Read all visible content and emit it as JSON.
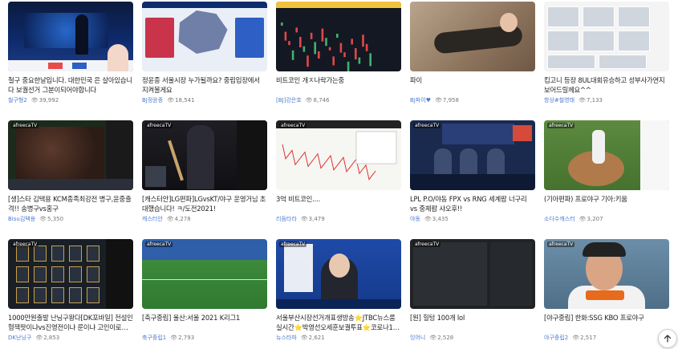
{
  "videos": [
    {
      "title": "철구 중요한날입니다. 대한민국 은 살아있습니다 보궐선거 그분이되어야합니다",
      "bj": "철구형2",
      "views": "39,992",
      "thumb": "news1",
      "badge": ""
    },
    {
      "title": "정윤종 서울시장 누가될까요? 중립입장에서 지켜볼게요",
      "bj": "BJ정윤종",
      "views": "18,541",
      "thumb": "news2",
      "badge": ""
    },
    {
      "title": "비트코인 개ㅈ나락가는중",
      "bj": "[BJ]강은호",
      "views": "8,746",
      "thumb": "btc",
      "badge": ""
    },
    {
      "title": "파이",
      "bj": "BJ파이♥",
      "views": "7,958",
      "thumb": "couch",
      "badge": ""
    },
    {
      "title": "킴고니 등장 8UL대회유승하고 성부사가연지보어드릴께요^^",
      "bj": "항상#철영태",
      "views": "7,133",
      "thumb": "stream",
      "badge": ""
    },
    {
      "title": "[생]스타 김택용 KCM종족최강전 병구,윤중출격!! 송병구vs홍구",
      "bj": "Bisu김택용",
      "views": "5,350",
      "thumb": "sc",
      "badge": "afreecaTV"
    },
    {
      "title": "[캐스터안]LG편파]LGvsKT/야구 운영거님 초대했습니다! ㅋ/도전2021!",
      "bj": "캐스터안",
      "views": "4,278",
      "thumb": "base1",
      "badge": "afreecaTV"
    },
    {
      "title": "3억 비트코인....",
      "bj": "리듬타라",
      "views": "3,479",
      "thumb": "chart2",
      "badge": "afreecaTV"
    },
    {
      "title": "LPL P.O/야동 FPX vs RNG 세계팝 너구리 vs 중체팝 샤오후!!",
      "bj": "야동",
      "views": "3,435",
      "thumb": "lpl",
      "badge": "afreecaTV"
    },
    {
      "title": "(기아편파) 프로야구 기아:키움",
      "bj": "소다수캐스터",
      "views": "3,207",
      "thumb": "base2",
      "badge": "afreecaTV"
    },
    {
      "title": "1000만원출발 난닝구왕다[DK포바일] 전설인형잭팟이냐vs진영전이냐 룬이냐 고인이로구나 ...",
      "bj": "DK난닝구",
      "views": "2,853",
      "thumb": "card",
      "badge": "afreecaTV"
    },
    {
      "title": "[축구중립] 울산:서울 2021 K리그1",
      "bj": "축구중립1",
      "views": "2,793",
      "thumb": "soccer",
      "badge": "afreecaTV"
    },
    {
      "title": "서울부산시장선거개표생방송⭐JTBC뉴스룸실시간⭐박영선오세훈보궐투표⭐코로나19속...",
      "bj": "뉴스타파",
      "views": "2,621",
      "thumb": "press",
      "badge": "afreecaTV"
    },
    {
      "title": "[원] 힐텅 100개 lol",
      "bj": "잉어니",
      "views": "2,528",
      "thumb": "dark",
      "badge": "afreecaTV"
    },
    {
      "title": "[야구중립] 한화:SSG KBO 프로야구",
      "bj": "야구중립2",
      "views": "2,517",
      "thumb": "base3",
      "badge": "afreecaTV"
    }
  ],
  "icons": {
    "views": "viewer-icon",
    "scroll_top": "arrow-up-icon"
  },
  "colors": {
    "bj_link": "#4a7bd0",
    "meta": "#777777"
  }
}
